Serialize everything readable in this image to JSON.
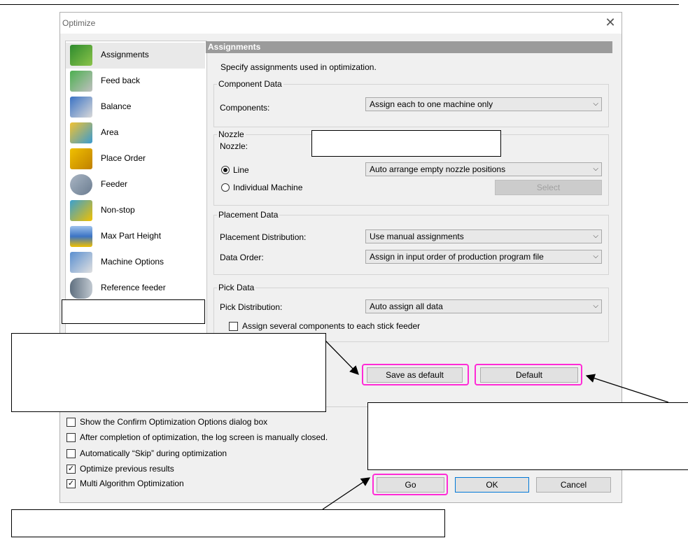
{
  "window": {
    "title": "Optimize"
  },
  "sidebar": {
    "items": [
      {
        "label": "Assignments",
        "icon": "assignments-icon",
        "color": "#3a9b3a"
      },
      {
        "label": "Feed back",
        "icon": "feedback-icon",
        "color": "#4caf50"
      },
      {
        "label": "Balance",
        "icon": "balance-icon",
        "color": "#5a8fd0"
      },
      {
        "label": "Area",
        "icon": "area-icon",
        "color": "#e0b020"
      },
      {
        "label": "Place Order",
        "icon": "place-order-icon",
        "color": "#d0a000"
      },
      {
        "label": "Feeder",
        "icon": "feeder-icon",
        "color": "#7a8ca0"
      },
      {
        "label": "Non-stop",
        "icon": "non-stop-icon",
        "color": "#3aa0d0"
      },
      {
        "label": "Max Part Height",
        "icon": "max-part-height-icon",
        "color": "#6a9ad0"
      },
      {
        "label": "Machine Options",
        "icon": "machine-options-icon",
        "color": "#5a8fd0"
      },
      {
        "label": "Reference feeder",
        "icon": "reference-feeder-icon",
        "color": "#607080"
      }
    ]
  },
  "panel": {
    "header": "Assignments",
    "description": "Specify assignments used in optimization.",
    "component_data": {
      "title": "Component Data",
      "components_label": "Components:",
      "components_value": "Assign each to one machine only"
    },
    "nozzle": {
      "title": "Nozzle",
      "nozzle_label": "Nozzle:",
      "line_label": "Line",
      "line_value": "Auto arrange empty nozzle positions",
      "individual_label": "Individual Machine",
      "select_label": "Select"
    },
    "placement_data": {
      "title": "Placement Data",
      "distribution_label": "Placement Distribution:",
      "distribution_value": "Use manual assignments",
      "order_label": "Data Order:",
      "order_value": "Assign in input order of production program file"
    },
    "pick_data": {
      "title": "Pick Data",
      "distribution_label": "Pick Distribution:",
      "distribution_value": "Auto assign all data",
      "stick_feeder_label": "Assign several components to each stick feeder"
    },
    "save_default_label": "Save as default",
    "default_label": "Default"
  },
  "options": {
    "checkboxes": [
      {
        "label": "Show the Confirm Optimization Options dialog box",
        "checked": false
      },
      {
        "label": "After completion of optimization, the log screen is manually closed.",
        "checked": false
      },
      {
        "label": "Automatically “Skip” during optimization",
        "checked": false
      },
      {
        "label": "Optimize previous results",
        "checked": true
      },
      {
        "label": "Multi Algorithm Optimization",
        "checked": true
      }
    ]
  },
  "footer": {
    "go_label": "Go",
    "ok_label": "OK",
    "cancel_label": "Cancel"
  },
  "colors": {
    "highlight": "#ff2bd6",
    "header_bar": "#9b9b9b",
    "primary_border": "#0078d7"
  }
}
